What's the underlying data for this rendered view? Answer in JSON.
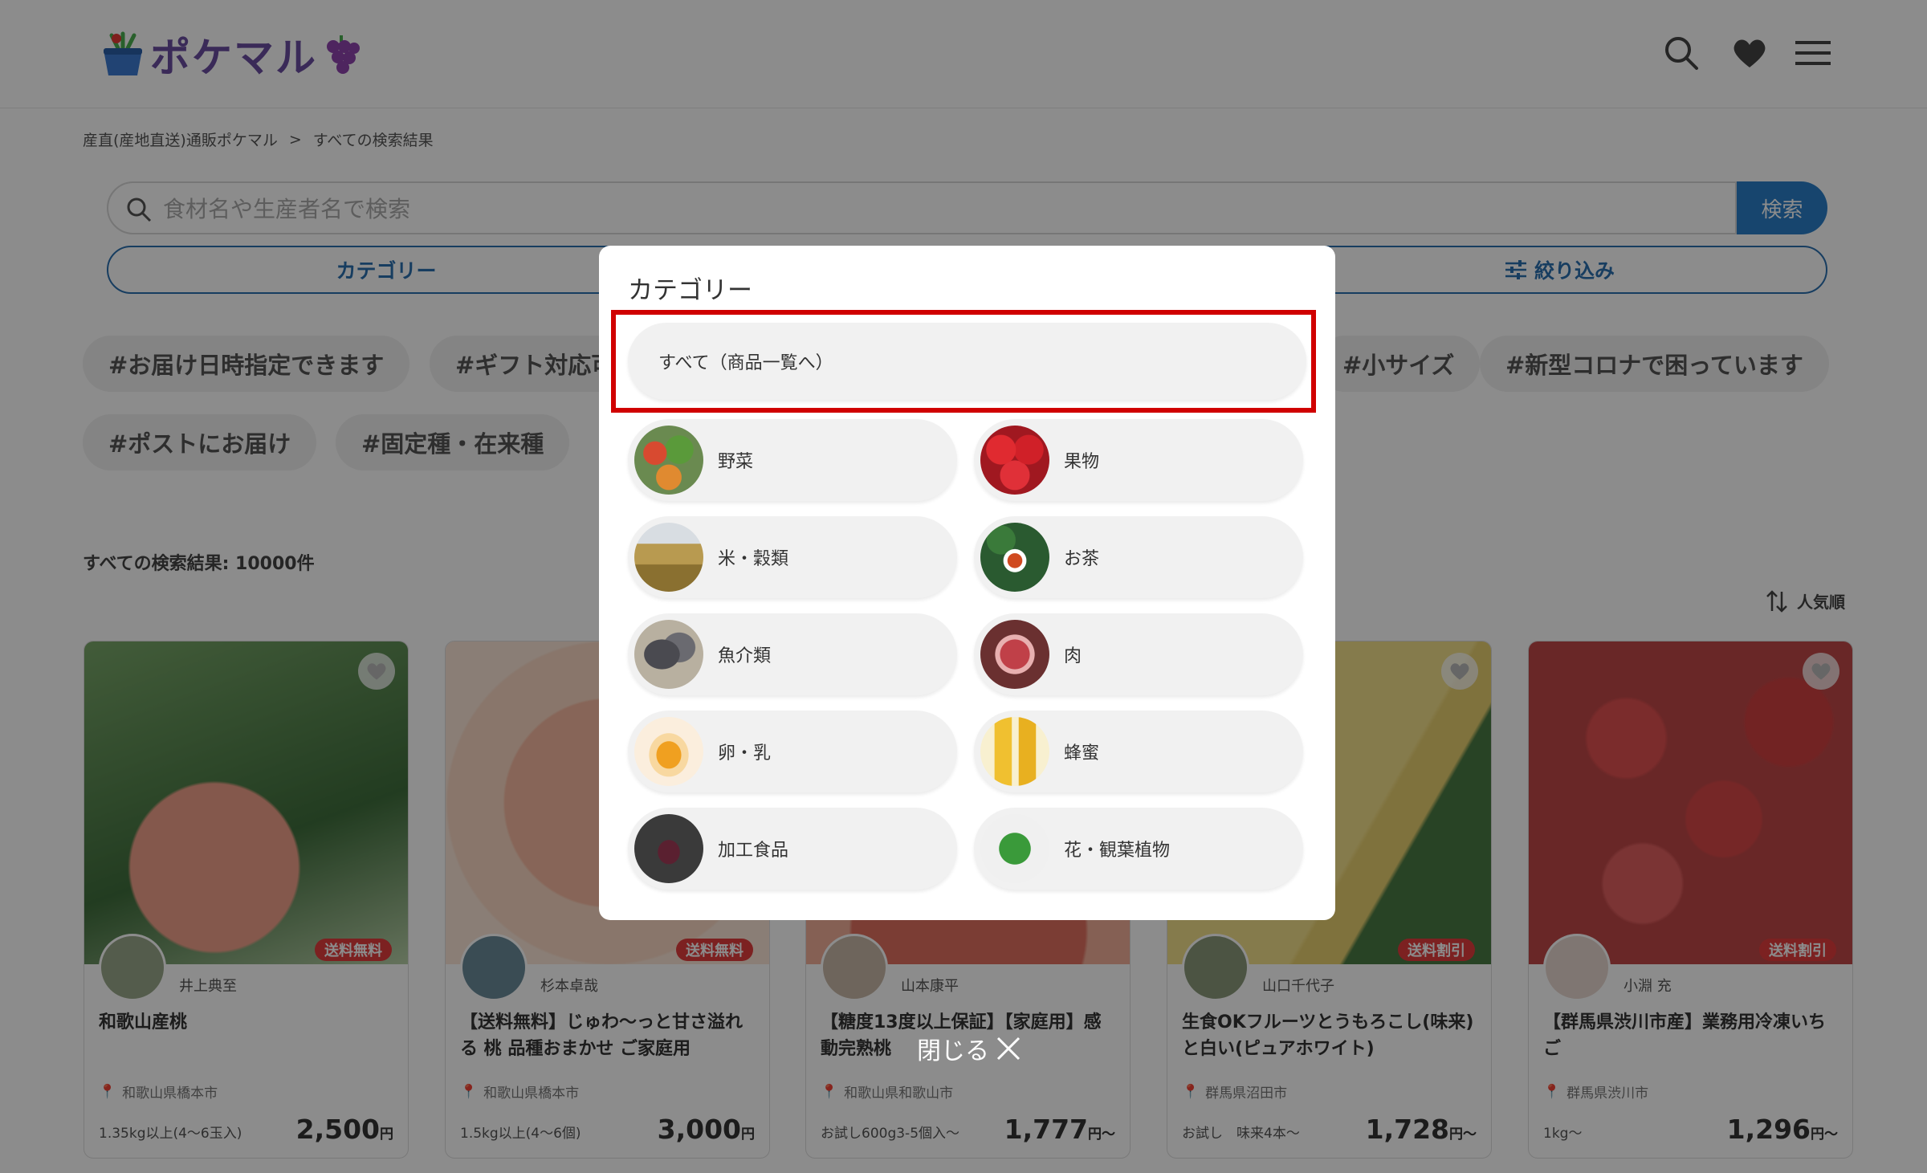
{
  "header": {
    "logo_text": "ポケマル",
    "icons": [
      "search-icon",
      "heart-icon",
      "menu-icon"
    ]
  },
  "breadcrumb": {
    "home": "産直(産地直送)通販ポケマル",
    "separator": ">",
    "current": "すべての検索結果"
  },
  "search": {
    "placeholder": "食材名や生産者名で検索",
    "button_label": "検索"
  },
  "filters": {
    "category_label": "カテゴリー",
    "refine_label": "絞り込み"
  },
  "tags": [
    "#お届け日時指定できます",
    "#ギフト対応可",
    "#小サイズ",
    "#新型コロナで困っています",
    "#ポストにお届け",
    "#固定種・在来種"
  ],
  "results": {
    "count_text": "すべての検索結果: 10000件",
    "sort_label": "人気順"
  },
  "products": [
    {
      "producer": "井上典至",
      "badge": "送料無料",
      "title": "和歌山産桃",
      "location": "和歌山県橋本市",
      "quantity": "1.35kg以上(4〜6玉入)",
      "price": "2,500",
      "unit": "円"
    },
    {
      "producer": "杉本卓哉",
      "badge": "送料無料",
      "title": "【送料無料】じゅわ〜っと甘さ溢れる 桃 品種おまかせ ご家庭用",
      "location": "和歌山県橋本市",
      "quantity": "1.5kg以上(4〜6個)",
      "price": "3,000",
      "unit": "円"
    },
    {
      "producer": "山本康平",
      "badge": "",
      "title": "【糖度13度以上保証】【家庭用】感動完熟桃",
      "location": "和歌山県和歌山市",
      "quantity": "お試し600g3-5個入～",
      "price": "1,777",
      "unit": "円～"
    },
    {
      "producer": "山口千代子",
      "badge": "送料割引",
      "title": "生食OKフルーツとうもろこし(味来)と白い(ピュアホワイト)",
      "location": "群馬県沼田市",
      "quantity": "お試し　味来4本～",
      "price": "1,728",
      "unit": "円～"
    },
    {
      "producer": "小淵 充",
      "badge": "送料割引",
      "title": "【群馬県渋川市産】業務用冷凍いちご",
      "location": "群馬県渋川市",
      "quantity": "1kg～",
      "price": "1,296",
      "unit": "円～"
    }
  ],
  "modal": {
    "title": "カテゴリー",
    "all_label": "すべて（商品一覧へ）",
    "categories": [
      {
        "label": "野菜",
        "icon": "vegetables-thumb"
      },
      {
        "label": "果物",
        "icon": "apples-thumb"
      },
      {
        "label": "米・穀類",
        "icon": "rice-field-thumb"
      },
      {
        "label": "お茶",
        "icon": "tea-thumb"
      },
      {
        "label": "魚介類",
        "icon": "seafood-thumb"
      },
      {
        "label": "肉",
        "icon": "meat-thumb"
      },
      {
        "label": "卵・乳",
        "icon": "egg-thumb"
      },
      {
        "label": "蜂蜜",
        "icon": "honey-thumb"
      },
      {
        "label": "加工食品",
        "icon": "jar-thumb"
      },
      {
        "label": "花・観葉植物",
        "icon": "plant-thumb"
      }
    ],
    "close_label": "閉じる"
  },
  "colors": {
    "accent_blue": "#2a7fc8",
    "highlight_red": "#d00000",
    "badge_red": "#e23c3c"
  }
}
